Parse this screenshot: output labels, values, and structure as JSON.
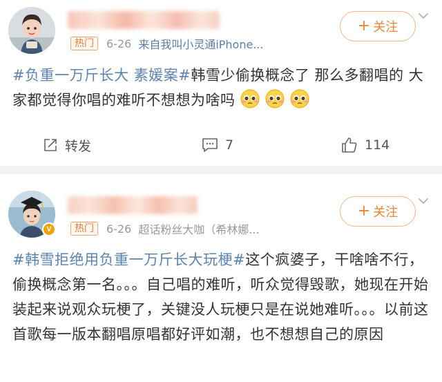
{
  "colors": {
    "topic_link": "#5b84b1",
    "follow_accent": "#f08338",
    "hot_tag": "#ee7a33",
    "meta_gray": "#999999",
    "separator": "#f2f2f2"
  },
  "posts": [
    {
      "hot_label": "热门",
      "time": "6-26",
      "source": "来自我叫小灵通iPhone...",
      "follow_label": "关注",
      "content": {
        "topic1": "#负重一万斤长大 素媛案#",
        "text": "韩雪少偷换概念了 那么多翻唱的 大家都觉得你唱的难听不想想为啥吗"
      },
      "emoji_icon": "pleading-face-emoji",
      "actions": {
        "repost_label": "转发",
        "comment_count": "7",
        "like_count": "114"
      }
    },
    {
      "hot_label": "热门",
      "time": "6-26",
      "source": "超话粉丝大咖（希林娜...",
      "follow_label": "关注",
      "verified_badge": "V",
      "content": {
        "topic1": "#韩雪拒绝用负重一万斤长大玩梗#",
        "text": "这个疯婆子，干啥啥不行，偷换概念第一名。。。自己唱的难听，听众觉得毁歌，她现在开始装起来说观众玩梗了，关键没人玩梗只是在说她难听。。。以前这首歌每一版本翻唱原唱都好评如潮，也不想想自己的原因"
      }
    }
  ]
}
